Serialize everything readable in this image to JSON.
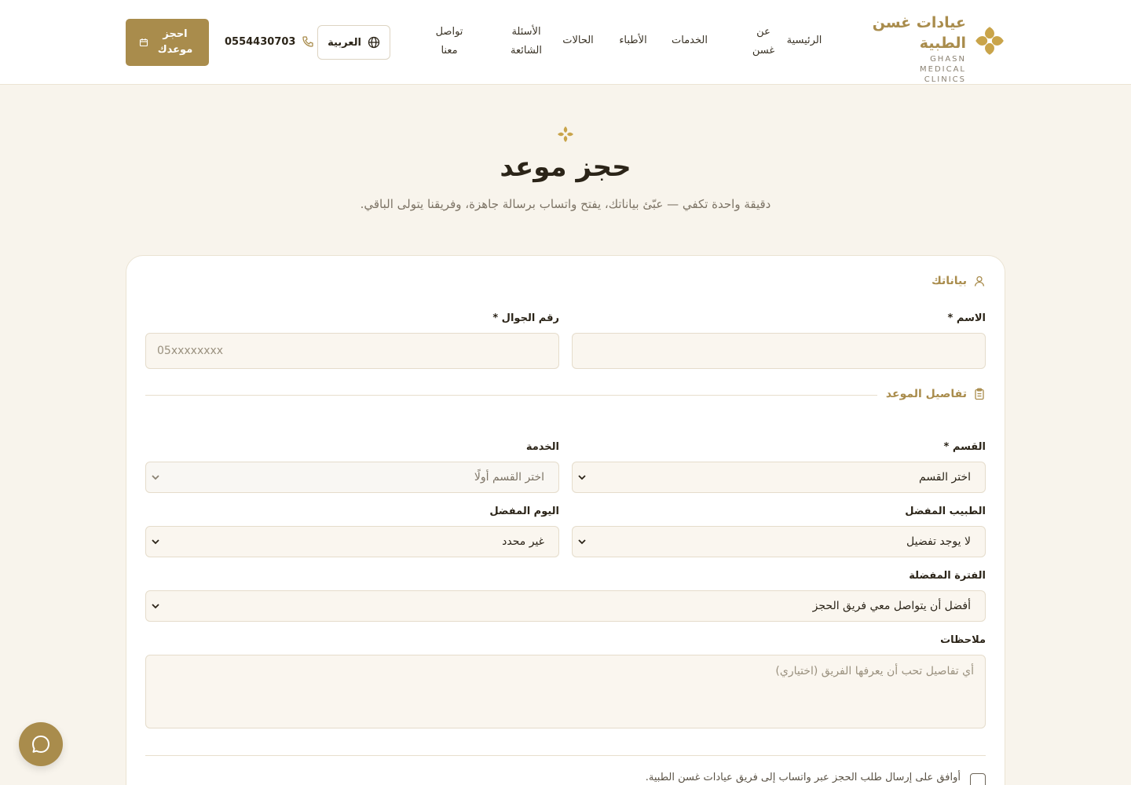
{
  "brand": {
    "name_ar": "عيادات غسن الطبية",
    "name_en": "GHASN MEDICAL CLINICS",
    "accent_color": "#a98c4c"
  },
  "nav": {
    "items": [
      {
        "label": "الرئيسية"
      },
      {
        "label": "عن غسن"
      },
      {
        "label": "الخدمات"
      },
      {
        "label": "الأطباء"
      },
      {
        "label": "الحالات"
      },
      {
        "label": "الأسئلة الشائعة"
      },
      {
        "label": "تواصل معنا"
      }
    ],
    "language_label": "العربية",
    "phone": "0554430703",
    "book_label": "احجز موعدك"
  },
  "hero": {
    "title": "حجز موعد",
    "subtitle": "دقيقة واحدة تكفي — عبّئ بياناتك، يفتح واتساب برسالة جاهزة، وفريقنا يتولى الباقي."
  },
  "form": {
    "personal_section": "بياناتك",
    "name_label": "الاسم *",
    "name_value": "",
    "phone_label": "رقم الجوال *",
    "phone_placeholder": "05xxxxxxxx",
    "details_section": "تفاصيل الموعد",
    "department_label": "القسم *",
    "department_value": "اختر القسم",
    "service_label": "الخدمة",
    "service_value": "اختر القسم أولًا",
    "doctor_label": "الطبيب المفضل",
    "doctor_value": "لا يوجد تفضيل",
    "day_label": "اليوم المفضل",
    "day_value": "غير محدد",
    "period_label": "الفترة المفضلة",
    "period_value": "أفضل أن يتواصل معي فريق الحجز",
    "notes_label": "ملاحظات",
    "notes_placeholder": "أي تفاصيل تحب أن يعرفها الفريق (اختياري)",
    "consent_text": "أوافق على إرسال طلب الحجز عبر واتساب إلى فريق عيادات غسن الطبية."
  },
  "icons": {
    "logo": "ornament-logo-icon",
    "globe": "globe-icon",
    "phone": "phone-icon",
    "calendar": "calendar-icon",
    "user": "user-icon",
    "clipboard": "clipboard-icon",
    "chat": "chat-bubble-icon"
  }
}
